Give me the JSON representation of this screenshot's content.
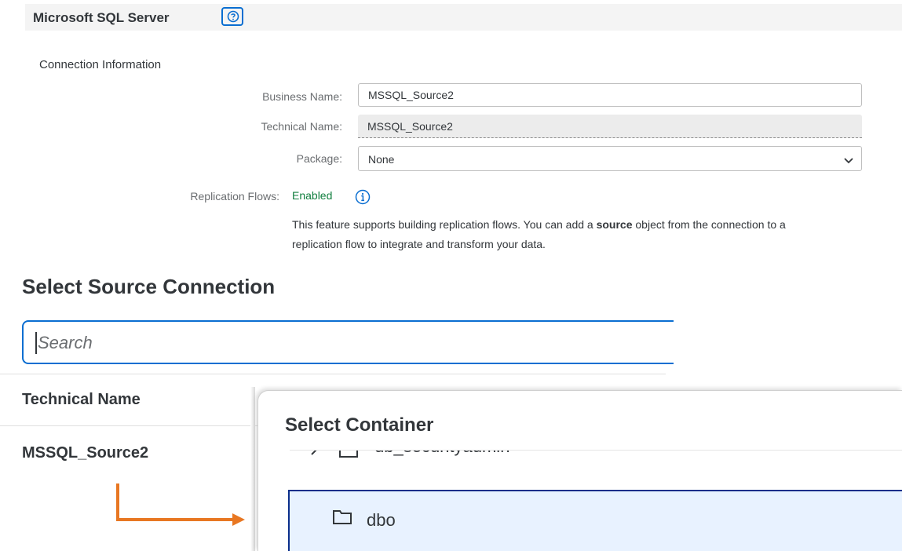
{
  "header": {
    "title": "Microsoft SQL Server"
  },
  "connection_info": {
    "section_label": "Connection Information",
    "business_name_label": "Business Name:",
    "business_name_value": "MSSQL_Source2",
    "technical_name_label": "Technical Name:",
    "technical_name_value": "MSSQL_Source2",
    "package_label": "Package:",
    "package_value": "None",
    "replication_label": "Replication Flows:",
    "replication_status": "Enabled",
    "description_part1": "This feature supports building replication flows. You can add a ",
    "description_bold": "source",
    "description_part2": " object from the connection to a replication flow to integrate and transform your data."
  },
  "source_connection": {
    "title": "Select Source Connection",
    "search_placeholder": "Search",
    "column_header": "Technical Name",
    "row_value": "MSSQL_Source2"
  },
  "container_dialog": {
    "title": "Select Container",
    "items": [
      {
        "label": "db_securityadmin"
      },
      {
        "label": "dbo",
        "selected": true
      }
    ]
  },
  "colors": {
    "accent": "#0a6ed1",
    "enabled_green": "#107e3e",
    "arrow_orange": "#e87722",
    "selection_bg": "#e8f2ff"
  },
  "icons": [
    "help-icon",
    "info-icon",
    "chevron-down-icon",
    "folder-icon",
    "chevron-right-icon",
    "arrow-icon"
  ]
}
